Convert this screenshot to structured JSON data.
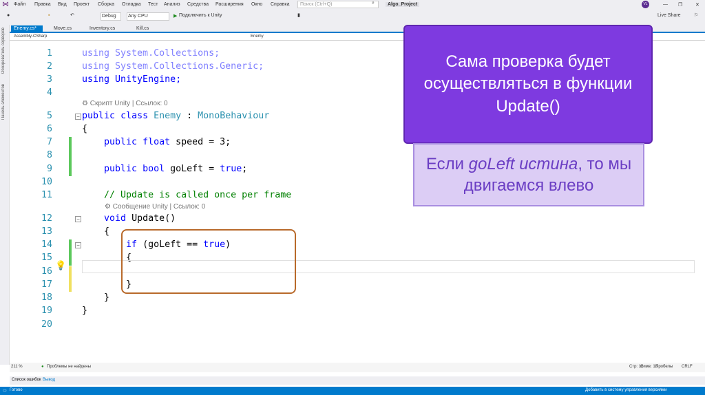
{
  "menu": [
    "Файл",
    "Правка",
    "Вид",
    "Проект",
    "Сборка",
    "Отладка",
    "Тест",
    "Анализ",
    "Средства",
    "Расширения",
    "Окно",
    "Справка"
  ],
  "search_placeholder": "Поиск (Ctrl+Q)",
  "project": "Algo_Project",
  "avatar": "VL",
  "toolbar": {
    "config": "Debug",
    "platform": "Any CPU",
    "run": "Подключить к Unity",
    "live_share": "Live Share"
  },
  "tabs": [
    "Enemy.cs*",
    "Move.cs",
    "Inventory.cs",
    "Kill.cs"
  ],
  "nav": {
    "assembly": "Assembly-CSharp",
    "class": "Enemy"
  },
  "left_rail": [
    "Обозреватель серверов",
    "Панель элементов"
  ],
  "code": {
    "l1": "using System.Collections;",
    "l2": "using System.Collections.Generic;",
    "l3": "using UnityEngine;",
    "lens1": "⚙ Скрипт Unity | Ссылок: 0",
    "lens2": "⚙ Сообщение Unity | Ссылок: 0",
    "public": "public",
    "class": "class",
    "enemy": "Enemy",
    "colon": " : ",
    "mono": "MonoBehaviour",
    "open": "{",
    "close": "}",
    "float": "float",
    "speed": " speed = 3;",
    "bool": "bool",
    "goleft": " goLeft = ",
    "true": "true",
    "semi": ";",
    "comment": "// Update is called once per frame",
    "void": "void",
    "update": " Update()",
    "if": "if",
    "cond": " (goLeft == ",
    "paren": ")"
  },
  "status": {
    "zoom": "211 %",
    "problems": "Проблемы не найдены",
    "line": "Стр: 16",
    "col": "Симв: 13",
    "spaces": "Пробелы",
    "eol": "CRLF"
  },
  "panels": [
    "Список ошибок",
    "Вывод"
  ],
  "statusbar": {
    "ready": "Готово",
    "vcs": "Добавить в систему управления версиями"
  },
  "callout1": "Сама проверка будет осуществляться в функции Update()",
  "callout2": {
    "a": "Если ",
    "b": "goLeft истина",
    "c": ", то мы двигаемся влево"
  }
}
